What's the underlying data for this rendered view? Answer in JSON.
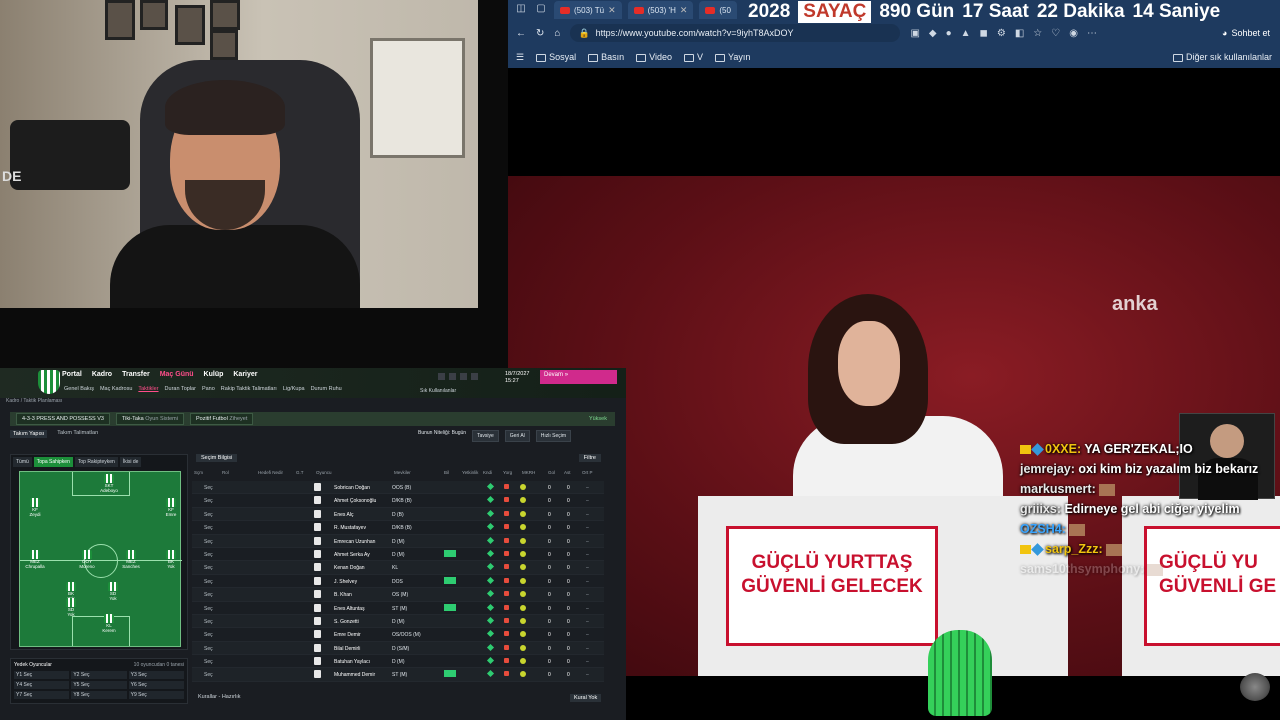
{
  "webcam": {
    "overlay_text": "DE"
  },
  "browser": {
    "tabs": [
      {
        "label": "(503) Tü"
      },
      {
        "label": "(503) 'H"
      },
      {
        "label": "(50"
      }
    ],
    "counter": {
      "year": "2028",
      "label": "SAYAÇ",
      "days": "890 Gün",
      "hours": "17 Saat",
      "minutes": "22 Dakika",
      "seconds": "14 Saniye"
    },
    "url": "https://www.youtube.com/watch?v=9iyhT8AxDOY",
    "chat_button": "Sohbet et",
    "bookmarks": [
      "Sosyal",
      "Basın",
      "Video",
      "V",
      "Yayın"
    ],
    "other_bookmarks": "Diğer sık kullanılanlar"
  },
  "video": {
    "watermark": "anka",
    "sign_line1": "GÜÇLÜ YURTTAŞ",
    "sign_line2": "GÜVENLİ GELECEK",
    "sign2_line1": "GÜÇLÜ YU",
    "sign2_line2": "GÜVENLİ GE",
    "chat": [
      {
        "user": "0XXE:",
        "text": "YA GER'ZEKAL;IO",
        "color": "#f1c40f",
        "badges": true,
        "faded": false
      },
      {
        "user": "jemrejay:",
        "text": "oxi kim biz yazalım biz bekarız",
        "color": "#e8e8e8",
        "badges": false,
        "faded": false
      },
      {
        "user": "markusmert:",
        "text": "",
        "color": "#e8e8e8",
        "badges": false,
        "faded": false
      },
      {
        "user": "griiixs:",
        "text": "Edirneye gel abi ciğer yiyelim",
        "color": "#e8e8e8",
        "badges": false,
        "faded": false
      },
      {
        "user": "OZSH4:",
        "text": "",
        "color": "#3aa5ff",
        "badges": false,
        "faded": false
      },
      {
        "user": "sarp_Zzz:",
        "text": "",
        "color": "#f1c40f",
        "badges": true,
        "faded": false
      },
      {
        "user": "sams10thsymphony:",
        "text": "",
        "color": "#e8e8e8",
        "badges": false,
        "faded": true
      }
    ]
  },
  "fm": {
    "menu": [
      "Portal",
      "Kadro",
      "Transfer",
      "Maç Günü",
      "Kulüp",
      "Kariyer"
    ],
    "active_menu": "Maç Günü",
    "submenu": [
      "Genel Bakış",
      "Maç Kadrosu",
      "Taktikler",
      "Duran Toplar",
      "Pano",
      "Rakip Taktik Talimatları",
      "Lig/Kupa",
      "Durum Ruhu"
    ],
    "active_submenu": "Taktikler",
    "date": "18/7/2027",
    "time": "15:27",
    "continue_label": "Devam",
    "search_label": "Ara",
    "shortcuts_label": "Sık Kullanılanlar",
    "breadcrumb": "Kadro / Taktik Planlaması",
    "tactic_name": "4-3-3 PRESS AND POSSESS V3",
    "style": "Tiki-Taka",
    "style_sub": "Oyun Sistemi",
    "mentality": "Pozitif Futbol",
    "mentality_sub": "Ziheyet",
    "familiarity": "Yüksek",
    "tabs": [
      "Takım Yapısı",
      "Takım Talimatları"
    ],
    "active_tab": "Takım Yapısı",
    "actions": [
      "Bunun Niteliği: Bugün",
      "Tavsiye",
      "Geri Al",
      "Hızlı Seçim"
    ],
    "pitch_filters": [
      "Tümü",
      "Topa Sahipken",
      "Top Rakipteyken",
      "İkisi de"
    ],
    "active_filter": "Topa Sahipken",
    "pitch_players": [
      {
        "role": "SKT",
        "name": "Adeboyo"
      },
      {
        "role": "KF",
        "name": "Zeydi"
      },
      {
        "role": "KF",
        "name": "Emre"
      },
      {
        "role": "MEZ",
        "name": "Chrupalla"
      },
      {
        "role": "ÖOY",
        "name": "Moreno"
      },
      {
        "role": "MEZ",
        "name": "Sanches"
      },
      {
        "role": "BK",
        "name": "Yok"
      },
      {
        "role": "BK",
        "name": "Yok"
      },
      {
        "role": "SD",
        "name": "Yok"
      },
      {
        "role": "SD",
        "name": "Yok"
      },
      {
        "role": "KL",
        "name": "Kerem"
      }
    ],
    "subs_title": "Yedek Oyuncular",
    "subs_count": "10 oyuncudan 0 tanesi",
    "subs": [
      "Y1 Seç",
      "Y2 Seç",
      "Y3 Seç",
      "Y4 Seç",
      "Y5 Seç",
      "Y6 Seç",
      "Y7 Seç",
      "Y8 Seç",
      "Y9 Seç"
    ],
    "selection_label": "Seçim Bilgisi",
    "filter_label": "Filtre",
    "columns": [
      "Sçm",
      "Rol",
      "Hedefi Nedir",
      "G.T",
      "Oyuncu",
      "Mevkiler",
      "Bil",
      "Yetkinlik",
      "Kndi",
      "Yorg",
      "MKRH",
      "Gol",
      "Ast",
      "Ort P"
    ],
    "squad": [
      {
        "select": "Seç",
        "name": "Sobrican Doğan",
        "pos": "OOS (B)",
        "badge": false,
        "n1": "0",
        "n2": "0"
      },
      {
        "select": "Seç",
        "name": "Ahmet Çoksonoğlu",
        "pos": "D/KB (B)",
        "badge": false,
        "n1": "0",
        "n2": "0"
      },
      {
        "select": "Seç",
        "name": "Enes Alç",
        "pos": "D (B)",
        "badge": false,
        "n1": "0",
        "n2": "0"
      },
      {
        "select": "Seç",
        "name": "R. Mustafayev",
        "pos": "D/KB (B)",
        "badge": false,
        "n1": "0",
        "n2": "0"
      },
      {
        "select": "Seç",
        "name": "Emrecan Uzunhan",
        "pos": "D (M)",
        "badge": false,
        "n1": "0",
        "n2": "0"
      },
      {
        "select": "Seç",
        "name": "Ahmet Serka Ay",
        "pos": "D (M)",
        "badge": true,
        "n1": "0",
        "n2": "0"
      },
      {
        "select": "Seç",
        "name": "Kenan Doğan",
        "pos": "KL",
        "badge": false,
        "n1": "0",
        "n2": "0"
      },
      {
        "select": "Seç",
        "name": "J. Shelvey",
        "pos": "DOS",
        "badge": true,
        "n1": "0",
        "n2": "0"
      },
      {
        "select": "Seç",
        "name": "B. Khan",
        "pos": "OS (M)",
        "badge": false,
        "n1": "0",
        "n2": "0"
      },
      {
        "select": "Seç",
        "name": "Enes Altuntaş",
        "pos": "ST (M)",
        "badge": true,
        "n1": "0",
        "n2": "0"
      },
      {
        "select": "Seç",
        "name": "S. Gonzetti",
        "pos": "D (M)",
        "badge": false,
        "n1": "0",
        "n2": "0"
      },
      {
        "select": "Seç",
        "name": "Emre Demir",
        "pos": "OS/OOS (M)",
        "badge": false,
        "n1": "0",
        "n2": "0"
      },
      {
        "select": "Seç",
        "name": "Bilal Demirli",
        "pos": "D (S/M)",
        "badge": false,
        "n1": "0",
        "n2": "0"
      },
      {
        "select": "Seç",
        "name": "Batuhan Yaylacı",
        "pos": "D (M)",
        "badge": false,
        "n1": "0",
        "n2": "0"
      },
      {
        "select": "Seç",
        "name": "Muhammed Demir",
        "pos": "ST (M)",
        "badge": true,
        "n1": "0",
        "n2": "0"
      }
    ],
    "bottom_left": "Kurallar - Hazırlık",
    "bottom_right": "Kural Yok"
  }
}
